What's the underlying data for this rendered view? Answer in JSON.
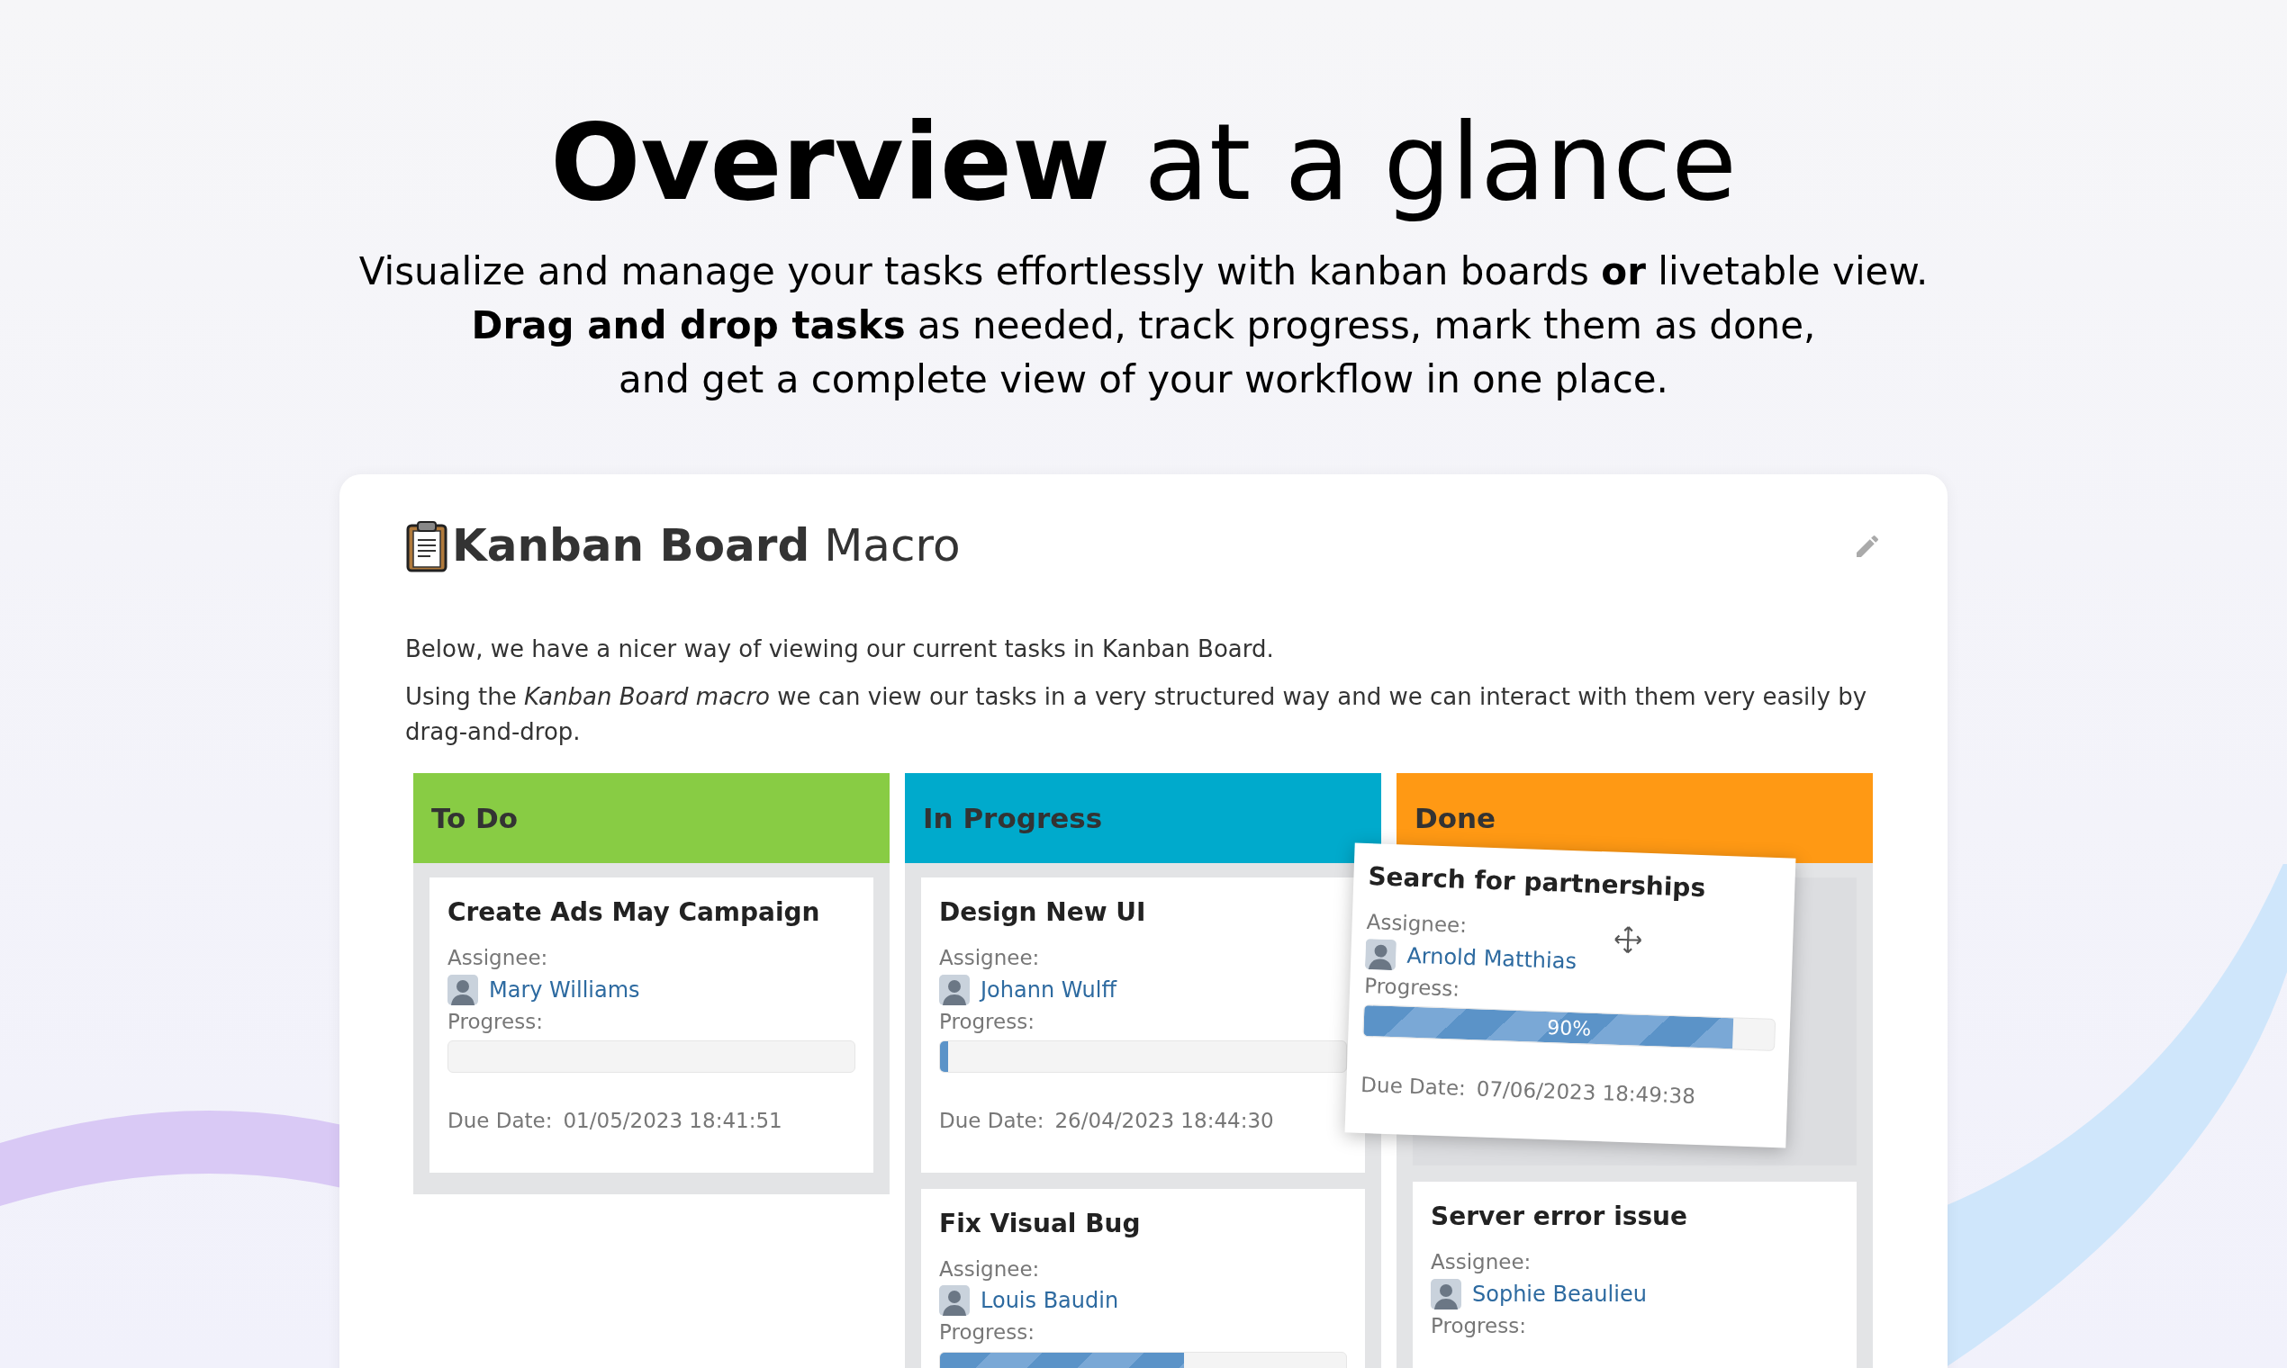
{
  "headline": {
    "bold": "Overview",
    "rest": "at a glance"
  },
  "intro": [
    "Visualize and manage your tasks effortlessly with kanban boards **or** livetable view.",
    "**Drag and drop tasks** as needed, track progress, mark them as done,",
    "and get a complete view of your workflow in one place."
  ],
  "panel": {
    "title_bold": "Kanban Board",
    "title_rest": "Macro",
    "paragraphs": [
      "Below, we have a nicer way of viewing our current tasks in Kanban Board.",
      "Using the *Kanban Board macro* we can view our tasks in a very structured way and we can interact with them very easily by drag-and-drop."
    ]
  },
  "columns": [
    {
      "title": "To Do",
      "color": "#88cc44",
      "cards": [
        {
          "title": "Create Ads May Campaign",
          "assignee_label": "Assignee:",
          "assignee": "Mary Williams",
          "progress_label": "Progress:",
          "level": 0,
          "due_label": "Due Date:",
          "due": "01/05/2023 18:41:51",
          "dragging": false
        }
      ]
    },
    {
      "title": "In Progress",
      "color": "#00aacc",
      "cards": [
        {
          "title": "Design New UI",
          "assignee_label": "Assignee:",
          "assignee": "Johann Wulff",
          "progress_label": "Progress:",
          "level": 0.02,
          "due_label": "Due Date:",
          "due": "26/04/2023 18:44:30",
          "dragging": false
        },
        {
          "title": "Fix Visual Bug",
          "assignee_label": "Assignee:",
          "assignee": "Louis Baudin",
          "progress_label": "Progress:",
          "level": 0.6,
          "dragging": false
        }
      ]
    },
    {
      "title": "Done",
      "color": "#ff9914",
      "cards": [
        {
          "title": "Search for partnerships",
          "assignee_label": "Assignee:",
          "assignee": "Arnold Matthias",
          "progress_label": "Progress:",
          "level": 0.9,
          "progress_text": "90%",
          "due_label": "Due Date:",
          "due": "07/06/2023 18:49:38",
          "dragging": true
        },
        {
          "title": "Server error issue",
          "assignee_label": "Assignee:",
          "assignee": "Sophie Beaulieu",
          "progress_label": "Progress:",
          "dragging": false
        }
      ]
    }
  ]
}
